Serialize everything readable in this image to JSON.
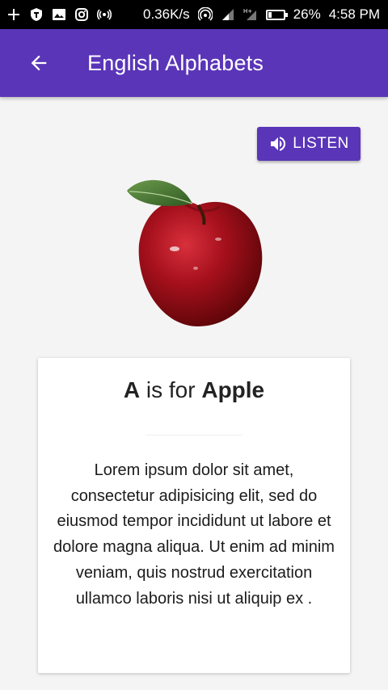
{
  "status_bar": {
    "network_speed": "0.36K/s",
    "battery": "26%",
    "time": "4:58 PM",
    "network_type": "H+",
    "battery_level": 0.26
  },
  "app_bar": {
    "title": "English Alphabets",
    "color": "#5a35b8"
  },
  "listen_button": {
    "label": "LISTEN"
  },
  "card": {
    "letter": "A",
    "middle": " is for ",
    "word": "Apple",
    "description": "Lorem ipsum dolor sit amet, consectetur adipisicing elit, sed do eiusmod tempor incididunt ut labore et dolore magna aliqua. Ut enim ad minim veniam, quis nostrud exercitation ullamco laboris nisi ut aliquip ex ."
  }
}
